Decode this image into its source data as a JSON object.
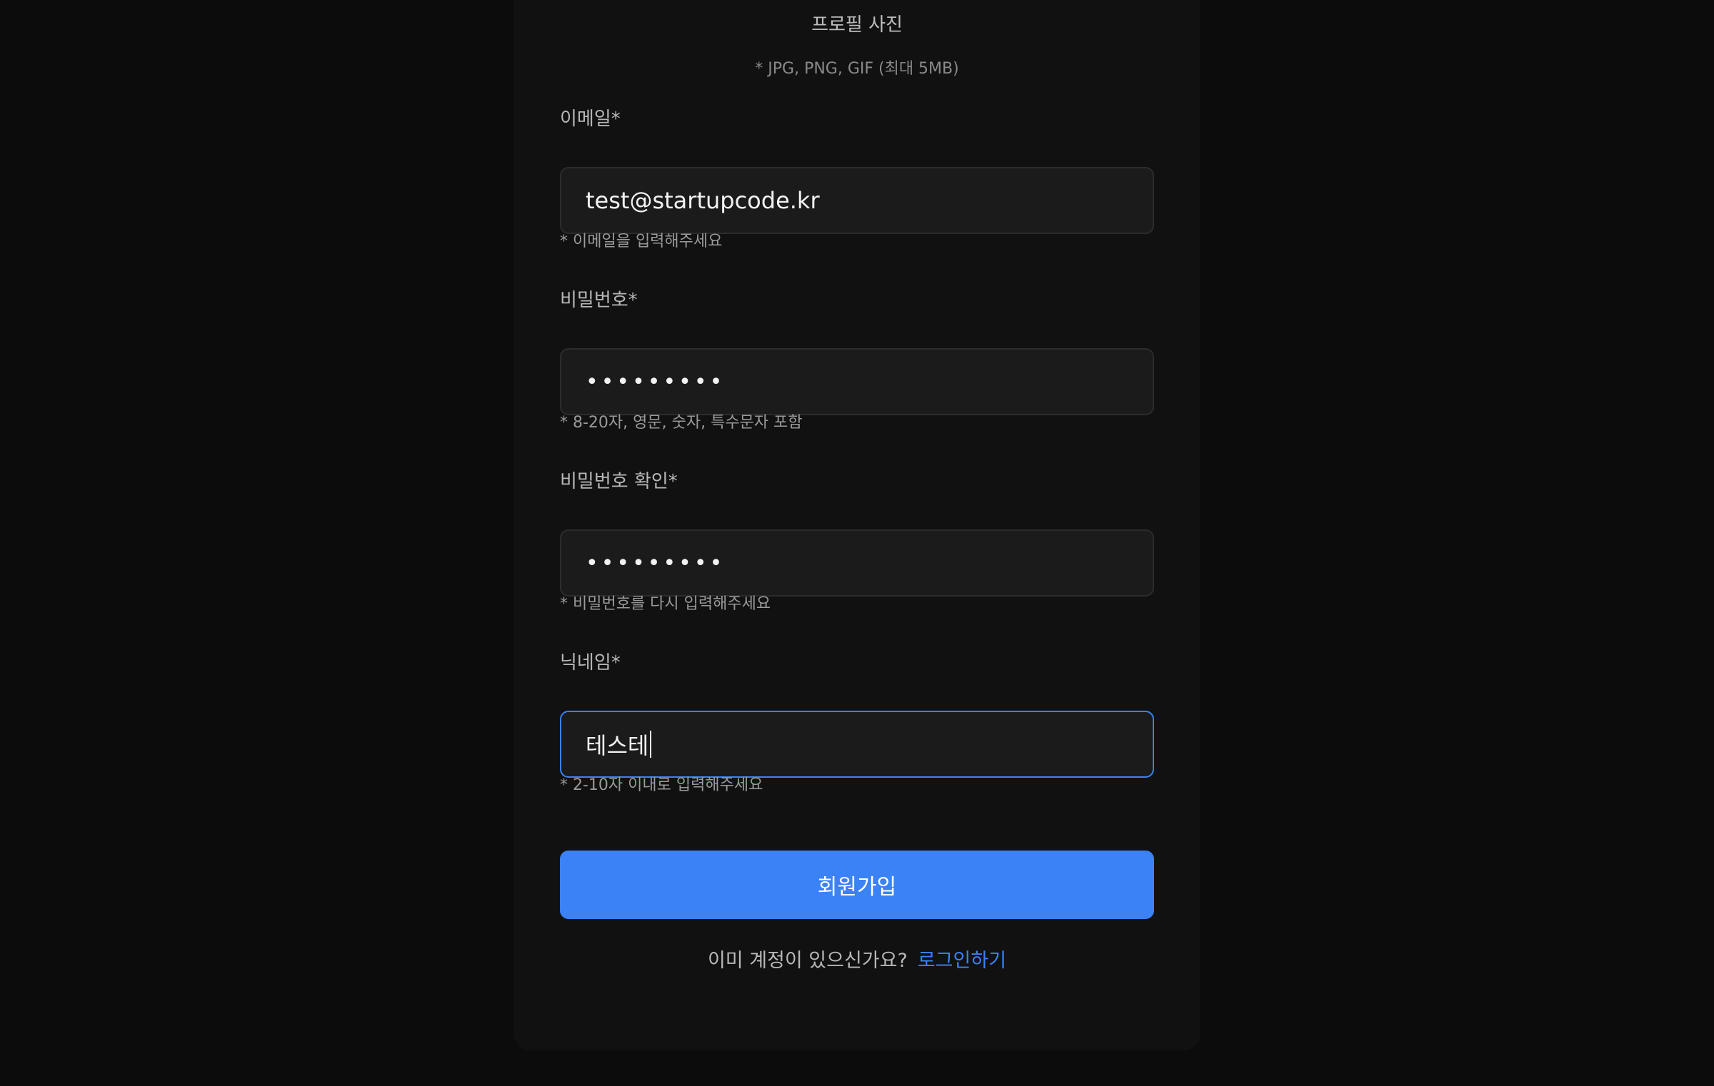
{
  "profile": {
    "label": "프로필 사진",
    "hint": "* JPG, PNG, GIF (최대 5MB)"
  },
  "email": {
    "label": "이메일*",
    "value": "test@startupcode.kr",
    "hint": "* 이메일을 입력해주세요"
  },
  "password": {
    "label": "비밀번호*",
    "value": "•••••••••",
    "hint": "* 8-20자, 영문, 숫자, 특수문자 포함"
  },
  "password_confirm": {
    "label": "비밀번호 확인*",
    "value": "•••••••••",
    "hint": "* 비밀번호를 다시 입력해주세요"
  },
  "nickname": {
    "label": "닉네임*",
    "value": "테스테",
    "hint": "* 2-10자 이내로 입력해주세요"
  },
  "submit_label": "회원가입",
  "login_prompt": {
    "question": "이미 계정이 있으신가요?",
    "link": "로그인하기"
  },
  "colors": {
    "accent": "#3b82f6",
    "background": "#0c0c0c",
    "card": "#111111",
    "input_bg": "#1b1b1b"
  }
}
